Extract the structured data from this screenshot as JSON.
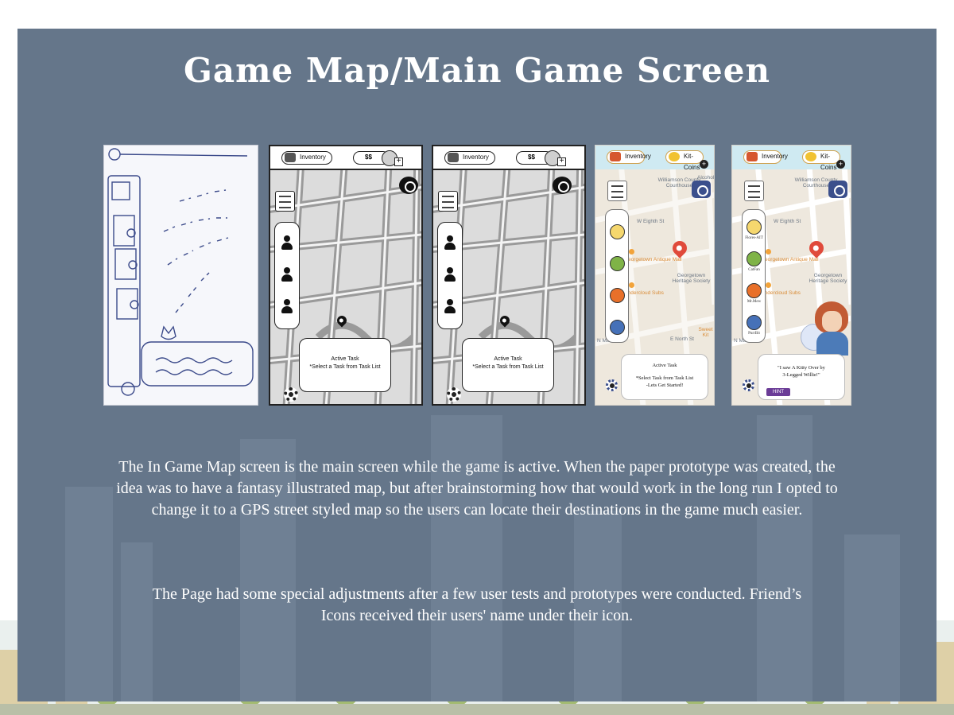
{
  "title": "Game Map/Main Game Screen",
  "wireframe": {
    "inventory_label": "Inventory",
    "money_label": "$$",
    "task_title": "Active Task",
    "task_body": "*Select a Task from Task List"
  },
  "final_design": {
    "inventory_label": "Inventory",
    "coins_label": "Kit-Coins",
    "task_title": "Active Task",
    "task_body": "*Select Task from Task List\n-Lets Get Started!",
    "friends": [
      "Flores-AIT",
      "CatFan",
      "Mr.Mew",
      "PurrBit"
    ],
    "task_quote": "\"I saw A Kitty Over by\n3-Legged Willie!\"",
    "hint_label": "HINT",
    "map_labels": {
      "williamson": "Williamson\nCounty\nCourthouse",
      "eighth_st": "W Eighth St",
      "georgetown_mall": "Georgetown\nAntique Mall",
      "heritage": "Georgetown\nHeritage Society",
      "undercloud": "Undercloud\nSubs",
      "sweet": "Sweet\nKit",
      "n_main": "N Main",
      "e_north": "E North St",
      "alcohol": "Alcohol B"
    }
  },
  "description": {
    "paragraph1": "The In Game Map screen is the main screen while the game is active.  When the paper prototype was created, the idea was to have a fantasy illustrated map, but after brainstorming how that would work in the long run I opted to change it to a GPS street styled map so the users can locate their destinations in the game much easier.",
    "paragraph2": "The Page had some special adjustments after a few user tests and prototypes were conducted.  Friend’s Icons received their users' name under their icon."
  },
  "colors": {
    "panel": "#65768a",
    "title_text": "#ffffff",
    "map_street": "#ffffff",
    "wire_map": "#dcdcdc",
    "pin": "#e04a3b",
    "hint": "#6b3c97",
    "skyline": "#d9c58f"
  }
}
